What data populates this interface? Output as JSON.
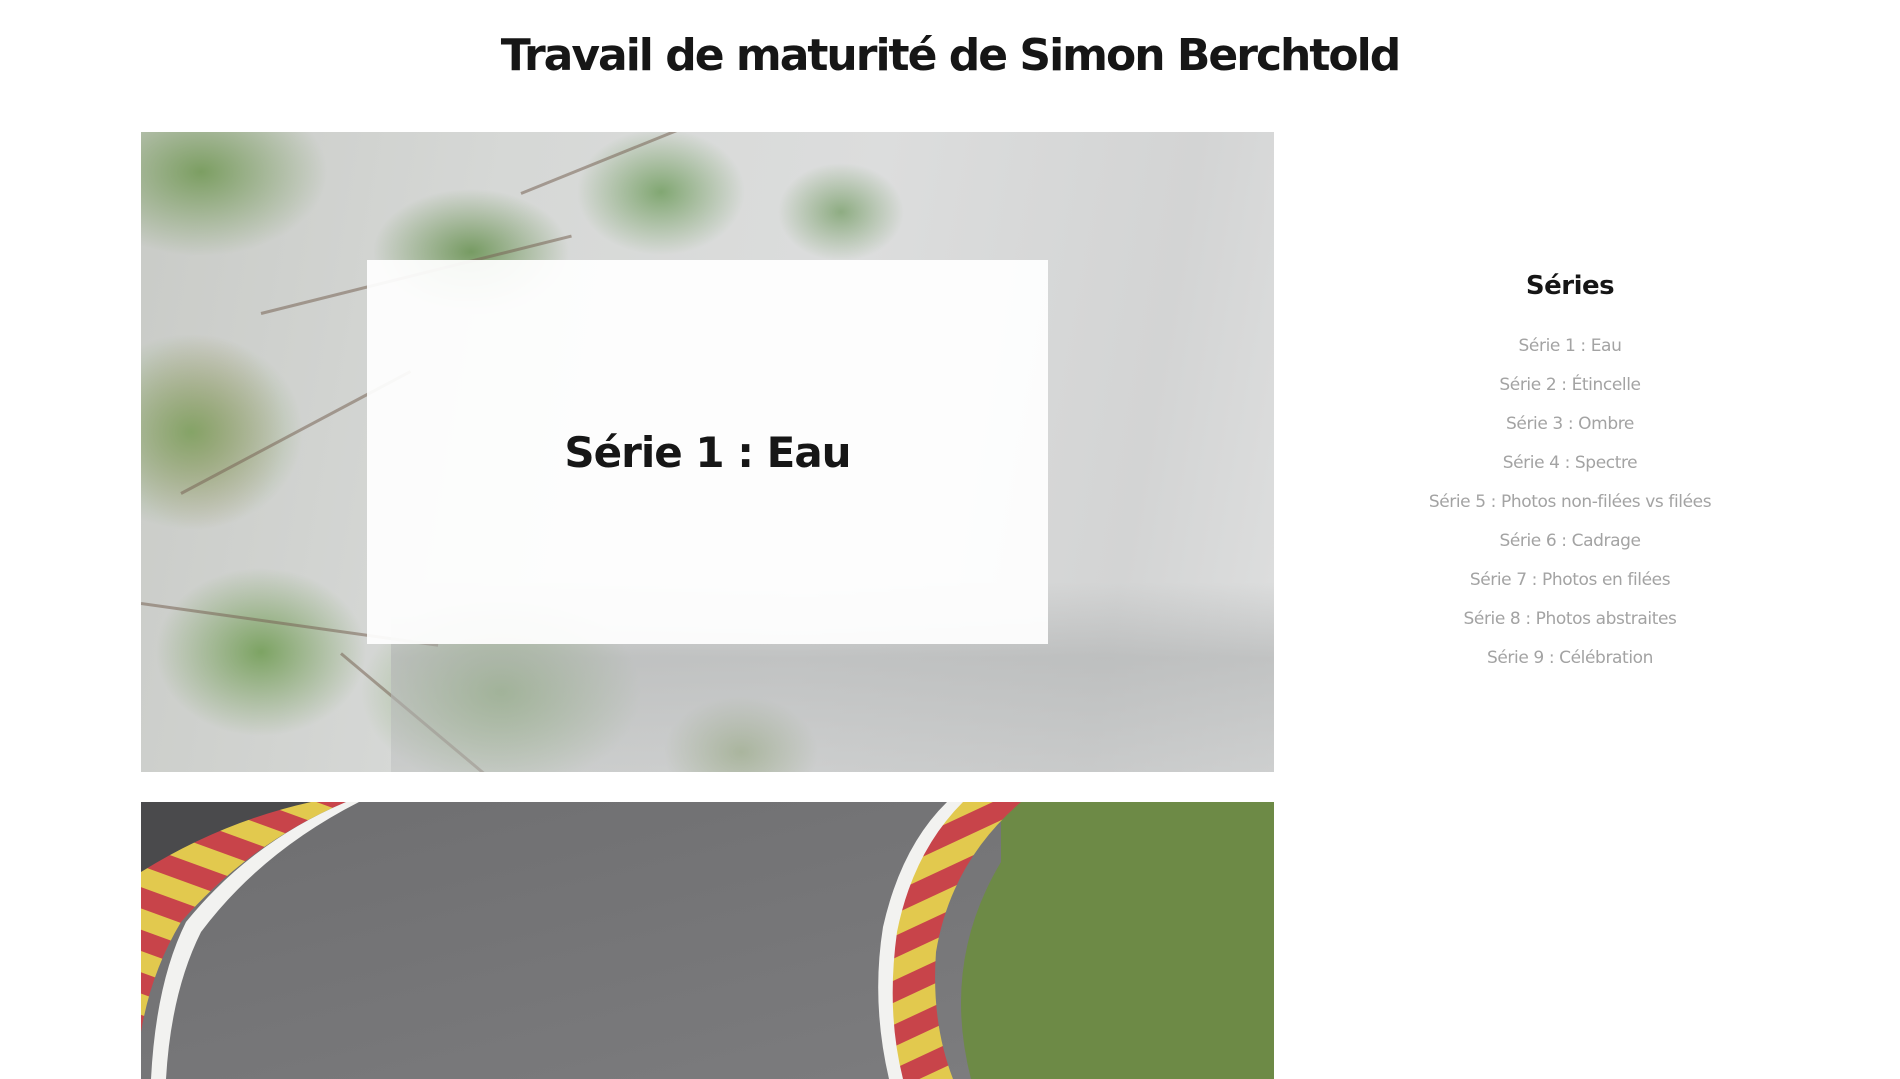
{
  "site": {
    "title": "Travail de maturité de Simon Berchtold"
  },
  "posts": [
    {
      "title": "Série 1 : Eau",
      "image": "blurred birch leaves over grey background"
    },
    {
      "title": "",
      "image": "race track curve with red and yellow kerbs"
    }
  ],
  "sidebar": {
    "heading": "Séries",
    "items": [
      {
        "label": "Série 1 : Eau"
      },
      {
        "label": "Série 2 : Étincelle"
      },
      {
        "label": "Série 3 : Ombre"
      },
      {
        "label": "Série 4 : Spectre"
      },
      {
        "label": "Série 5 : Photos non-filées vs filées"
      },
      {
        "label": "Série 6 : Cadrage"
      },
      {
        "label": "Série 7 : Photos en filées"
      },
      {
        "label": "Série 8 : Photos abstraites"
      },
      {
        "label": "Série 9 : Célébration"
      }
    ]
  },
  "colors": {
    "text": "#161616",
    "link": "#a3a3a3",
    "background": "#ffffff",
    "kerb_red": "#c8444a",
    "kerb_yellow": "#e2c94e",
    "grass": "#6d8a46",
    "asphalt": "#767678"
  }
}
